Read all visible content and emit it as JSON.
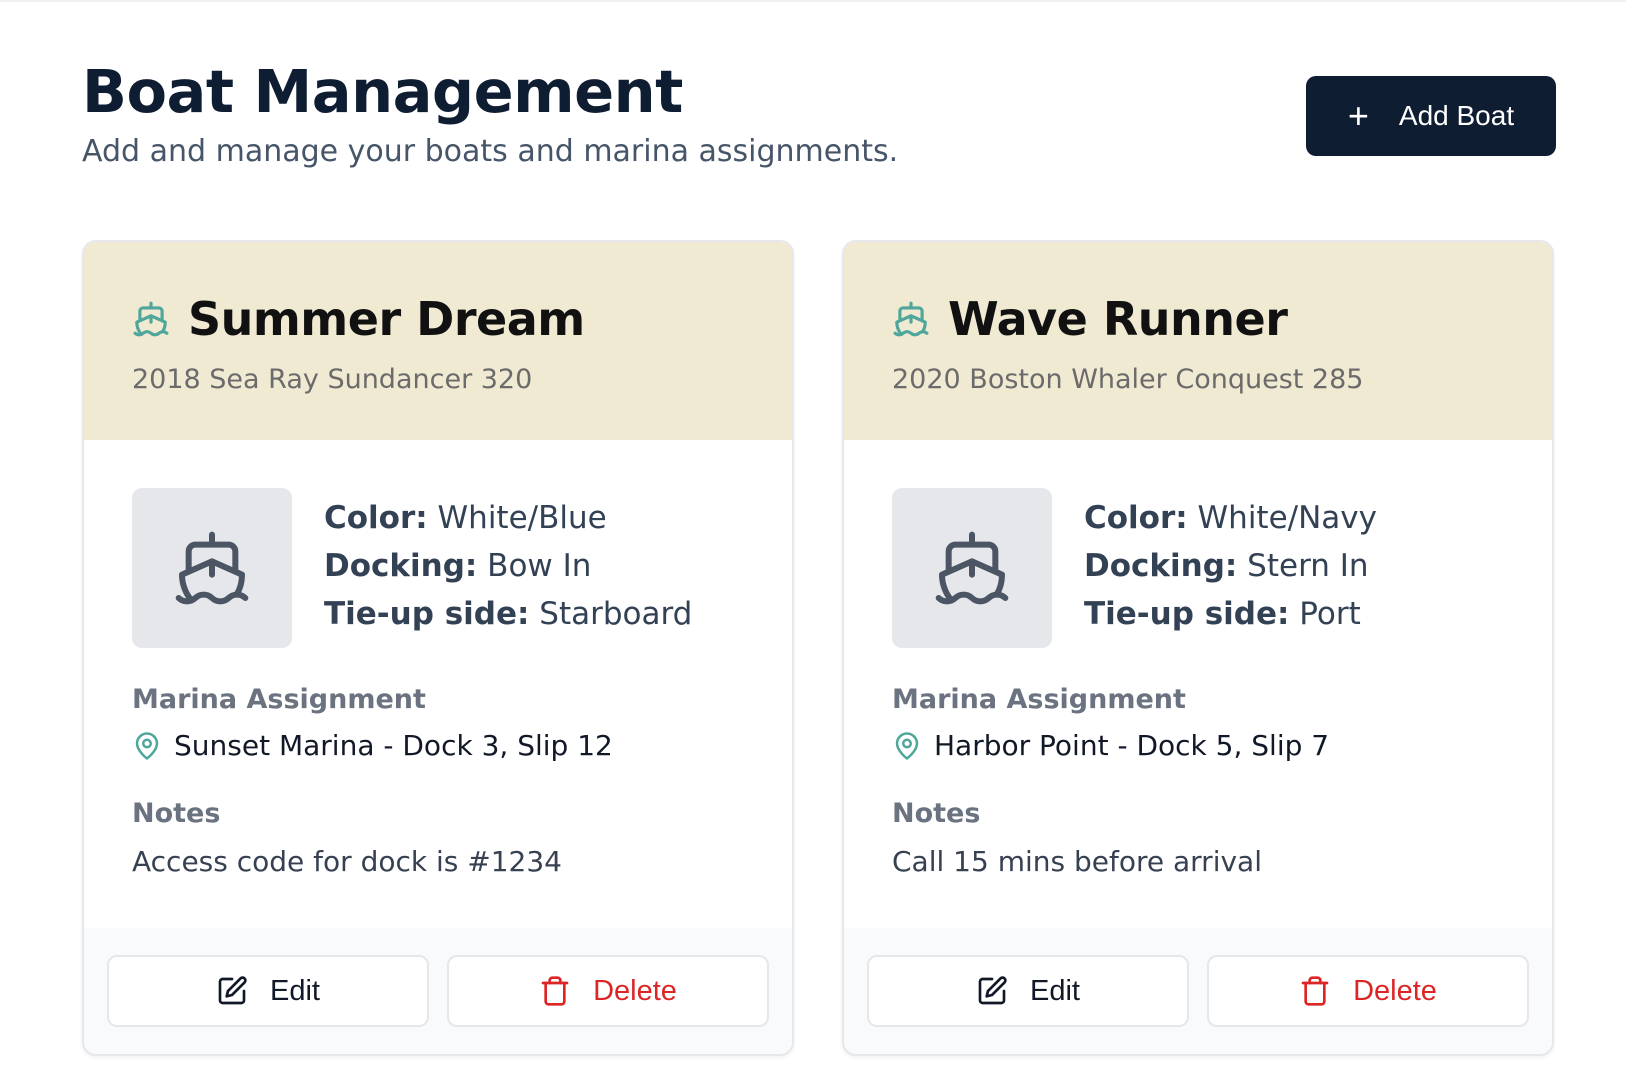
{
  "header": {
    "title": "Boat Management",
    "subtitle": "Add and manage your boats and marina assignments."
  },
  "add_button": {
    "icon": "plus-icon",
    "label": "Add Boat"
  },
  "labels": {
    "color": "Color:",
    "docking": "Docking:",
    "tieup": "Tie-up side:",
    "marina_assignment": "Marina Assignment",
    "notes": "Notes",
    "edit": "Edit",
    "delete": "Delete"
  },
  "boats": [
    {
      "name": "Summer Dream",
      "model": "2018 Sea Ray Sundancer 320",
      "color": "White/Blue",
      "docking": "Bow In",
      "tieup": "Starboard",
      "marina": "Sunset Marina - Dock 3, Slip 12",
      "notes": "Access code for dock is #1234"
    },
    {
      "name": "Wave Runner",
      "model": "2020 Boston Whaler Conquest 285",
      "color": "White/Navy",
      "docking": "Stern In",
      "tieup": "Port",
      "marina": "Harbor Point - Dock 5, Slip 7",
      "notes": "Call 15 mins before arrival"
    }
  ],
  "colors": {
    "primary": "#0f1d33",
    "card_header_bg": "#f1ead3",
    "accent_teal": "#4fa69a",
    "danger": "#dc2626"
  }
}
